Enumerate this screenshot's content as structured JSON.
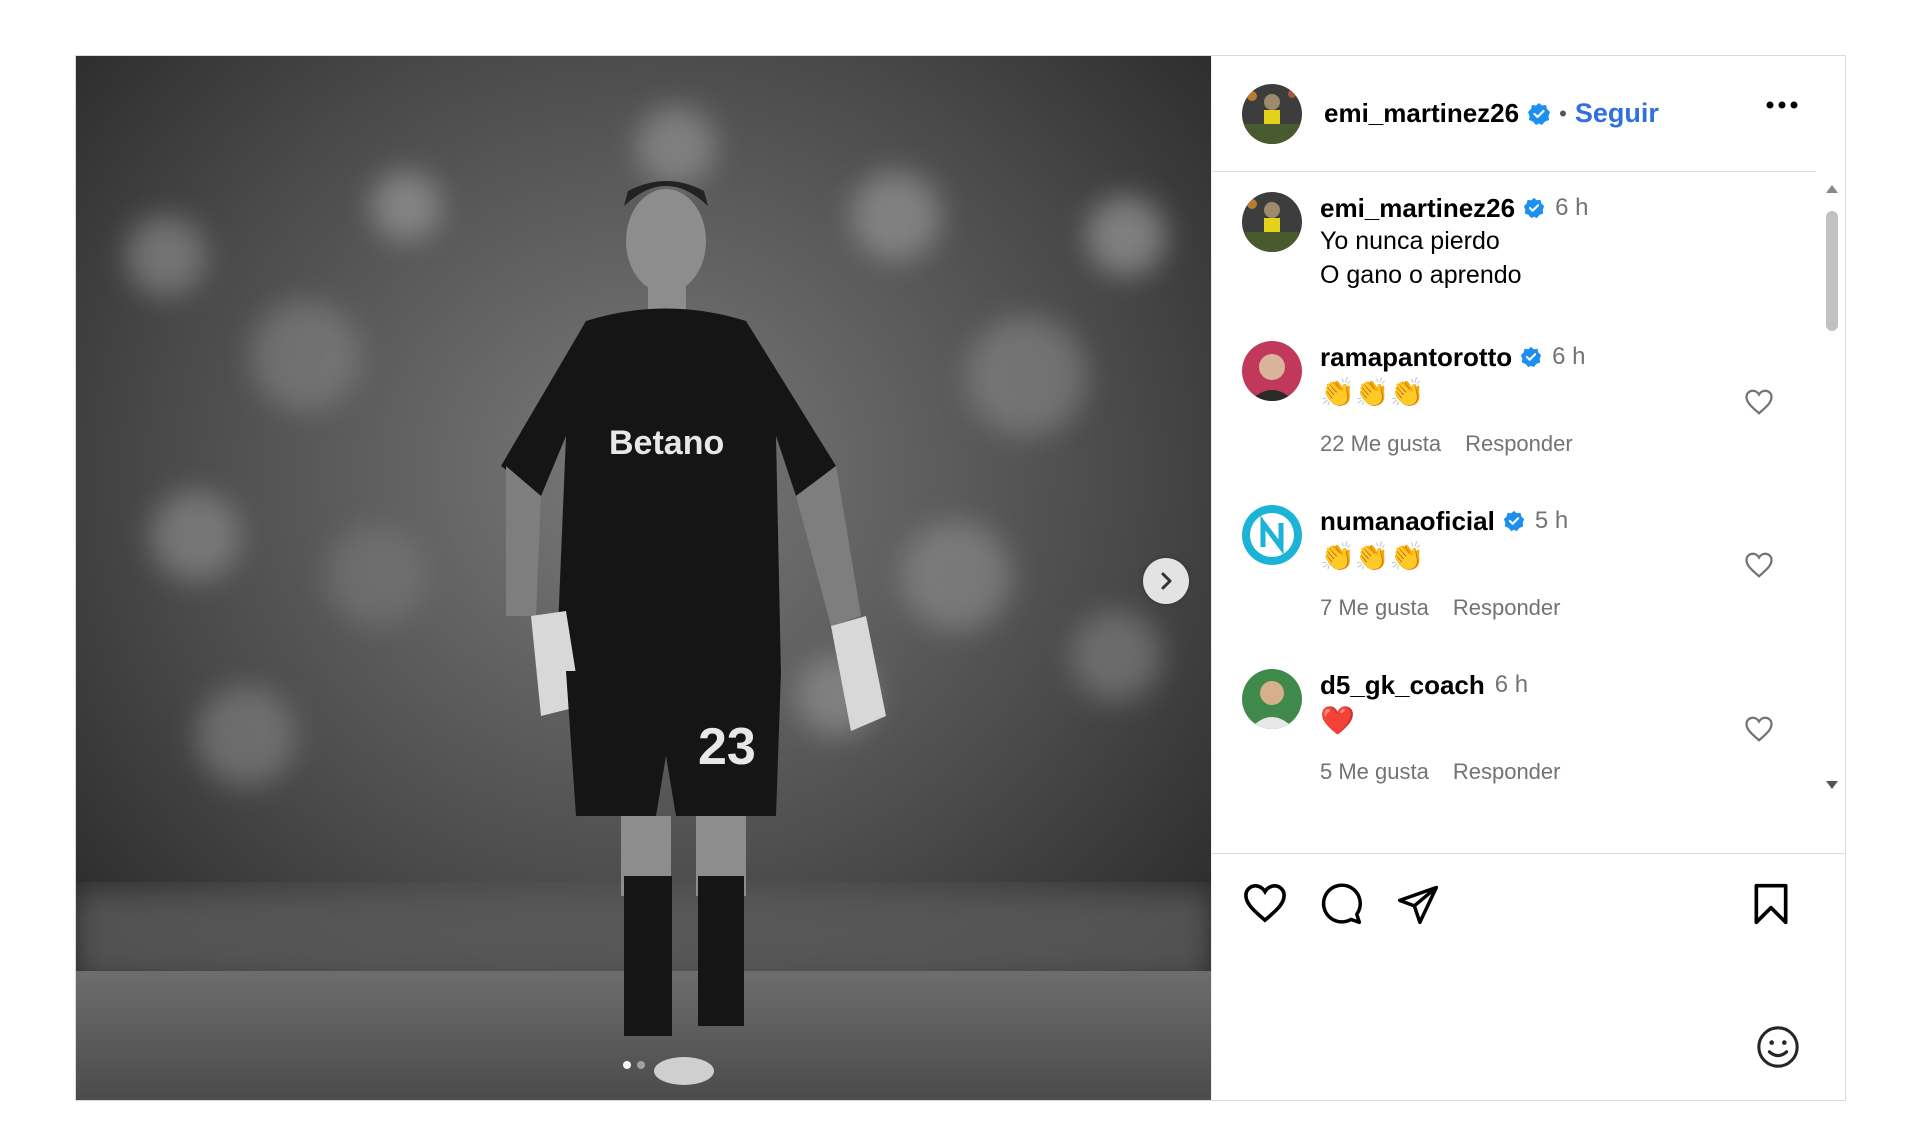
{
  "post": {
    "author": "emi_martinez26",
    "follow_label": "Seguir",
    "separator": "•",
    "photo_texts": {
      "sponsor": "Betano",
      "shirt_number": "23"
    },
    "caption": {
      "username": "emi_martinez26",
      "time": "6 h",
      "lines": [
        "Yo nunca pierdo",
        "O gano o aprendo"
      ]
    }
  },
  "comments": [
    {
      "username": "ramapantorotto",
      "verified": true,
      "time": "6 h",
      "text": "👏👏👏",
      "likes": "22 Me gusta",
      "reply": "Responder"
    },
    {
      "username": "numanaoficial",
      "verified": true,
      "time": "5 h",
      "text": "👏👏👏",
      "likes": "7 Me gusta",
      "reply": "Responder"
    },
    {
      "username": "d5_gk_coach",
      "verified": false,
      "time": "6 h",
      "text": "❤️",
      "likes": "5 Me gusta",
      "reply": "Responder"
    }
  ],
  "icons": [
    "more-options-icon",
    "verified-badge-icon",
    "heart-icon",
    "comment-icon",
    "share-icon",
    "bookmark-icon",
    "emoji-icon",
    "chevron-right-icon"
  ],
  "colors": {
    "link_blue": "#2f6fe0",
    "verified_blue": "#1d8ff0",
    "muted": "#737373"
  }
}
